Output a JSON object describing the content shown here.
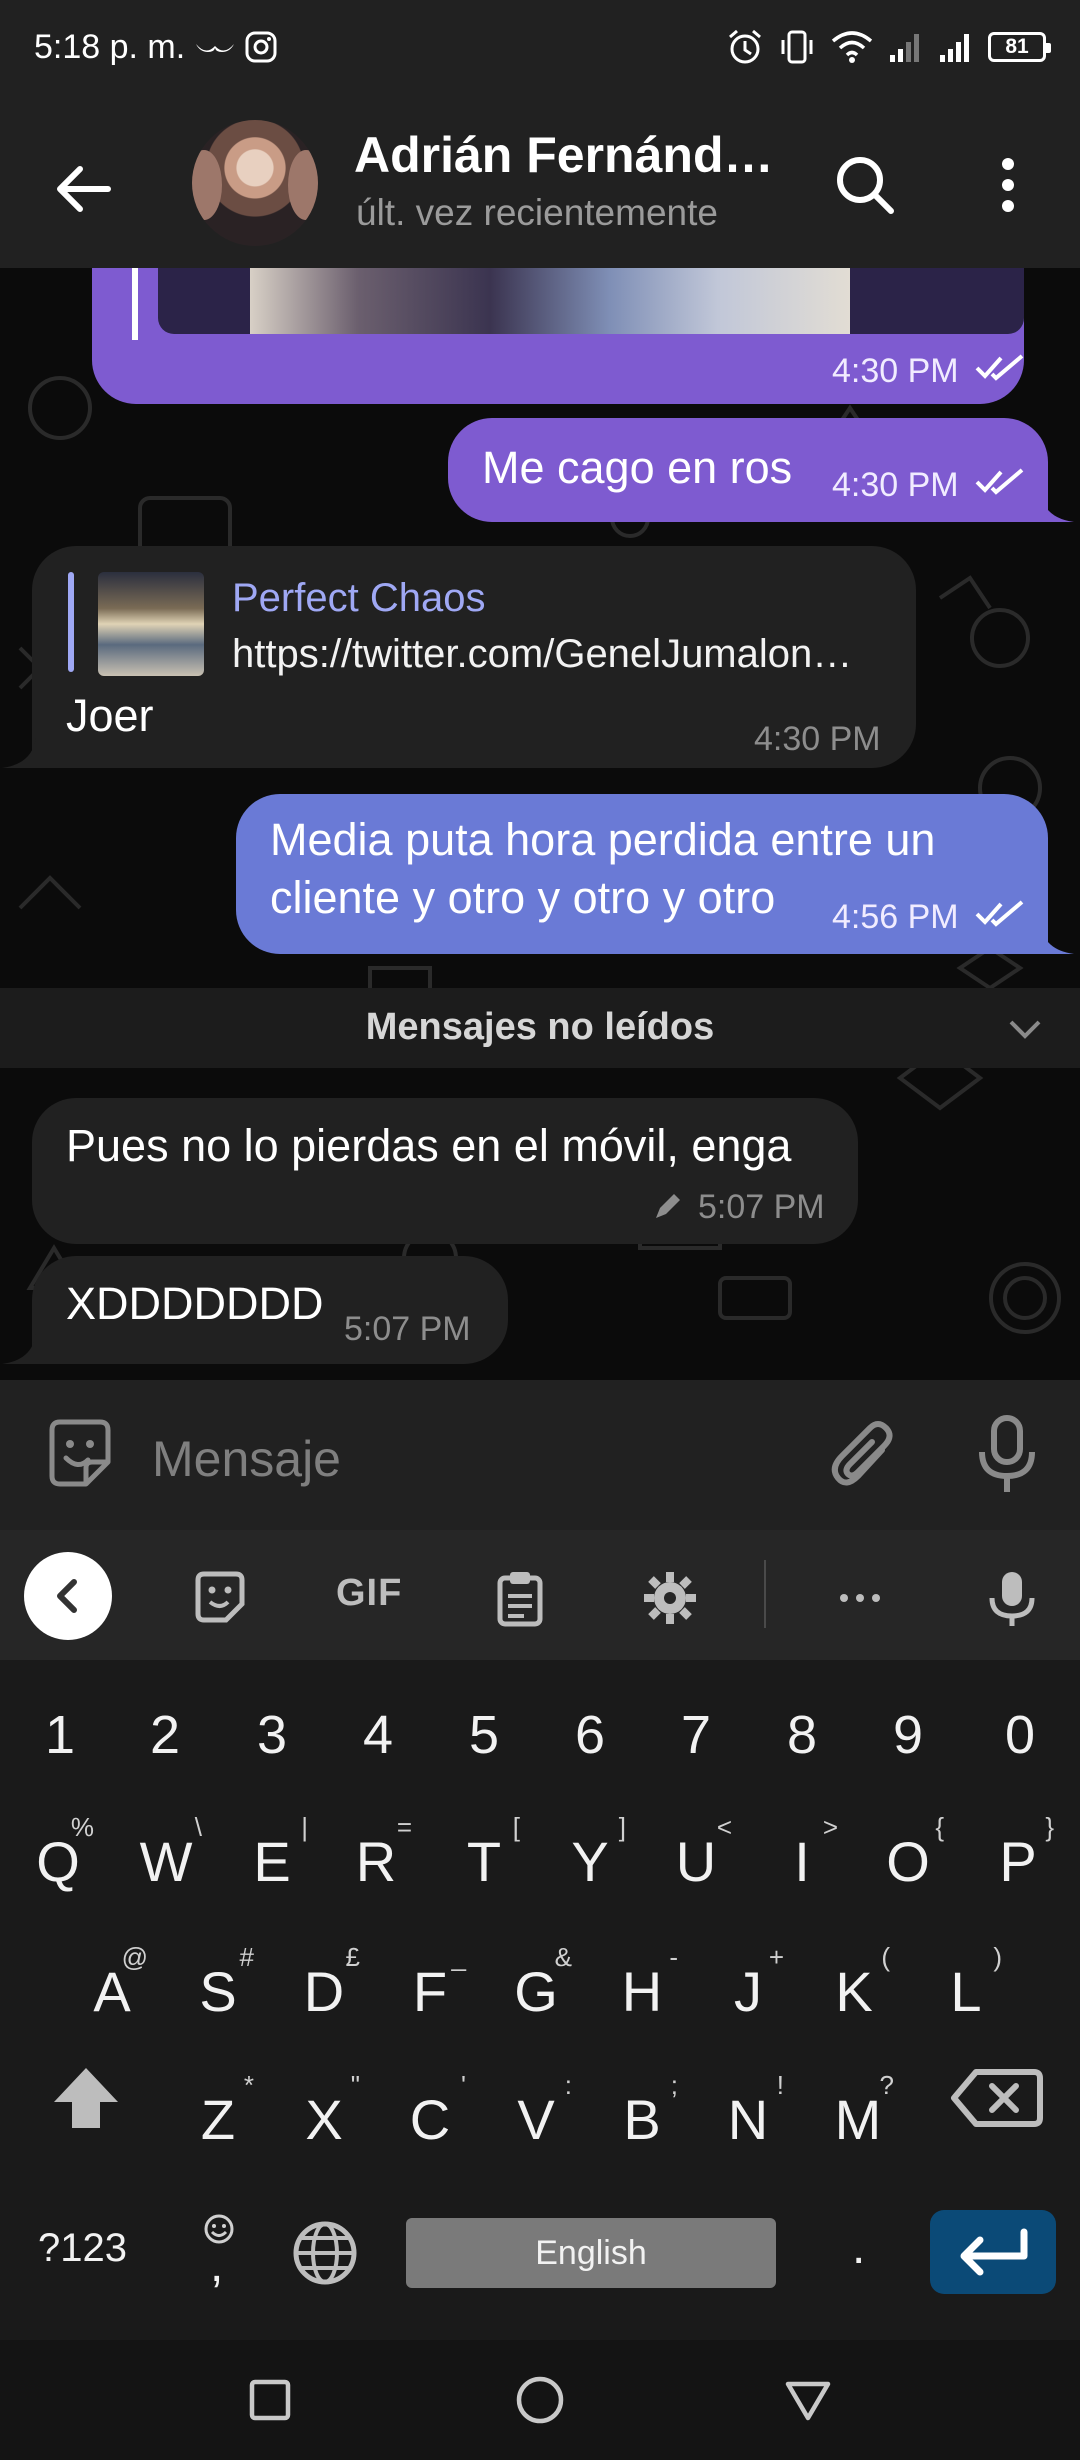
{
  "status_bar": {
    "time": "5:18 p. m.",
    "battery": "81",
    "icons": [
      "mustache-icon",
      "instagram-icon",
      "alarm-icon",
      "vibrate-icon",
      "wifi-icon",
      "signal-icon",
      "signal-icon-2"
    ]
  },
  "header": {
    "title": "Adrián Fernánd…",
    "subtitle": "últ. vez recientemente",
    "icons": [
      "back-arrow-icon",
      "search-icon",
      "more-vert-icon"
    ]
  },
  "messages": [
    {
      "id": "m0",
      "direction": "out",
      "text": "",
      "time": "4:30 PM",
      "read": true,
      "kind": "media"
    },
    {
      "id": "m1",
      "direction": "out",
      "text": "Me cago en ros",
      "time": "4:30 PM",
      "read": true
    },
    {
      "id": "m2",
      "direction": "in",
      "link_title": "Perfect Chaos",
      "link_url": "https://twitter.com/GenelJumalon…",
      "text": "Joer",
      "time": "4:30 PM"
    },
    {
      "id": "m3",
      "direction": "out",
      "lines": [
        "Media puta hora perdida entre un",
        "cliente y otro y otro y otro"
      ],
      "time": "4:56 PM",
      "read": true
    },
    {
      "id": "m4",
      "direction": "in",
      "text": "Pues no lo pierdas en el móvil, enga",
      "time": "5:07 PM",
      "edited": true
    },
    {
      "id": "m5",
      "direction": "in",
      "text": "XDDDDDDD",
      "time": "5:07 PM"
    }
  ],
  "unread_divider": "Mensajes no leídos",
  "composer": {
    "placeholder": "Mensaje"
  },
  "keyboard": {
    "toolbar_gif": "GIF",
    "number_row": [
      "1",
      "2",
      "3",
      "4",
      "5",
      "6",
      "7",
      "8",
      "9",
      "0"
    ],
    "row1": [
      {
        "k": "Q",
        "s": "%"
      },
      {
        "k": "W",
        "s": "\\"
      },
      {
        "k": "E",
        "s": "|"
      },
      {
        "k": "R",
        "s": "="
      },
      {
        "k": "T",
        "s": "["
      },
      {
        "k": "Y",
        "s": "]"
      },
      {
        "k": "U",
        "s": "<"
      },
      {
        "k": "I",
        "s": ">"
      },
      {
        "k": "O",
        "s": "{"
      },
      {
        "k": "P",
        "s": "}"
      }
    ],
    "row2": [
      {
        "k": "A",
        "s": "@"
      },
      {
        "k": "S",
        "s": "#"
      },
      {
        "k": "D",
        "s": "£"
      },
      {
        "k": "F",
        "s": "_"
      },
      {
        "k": "G",
        "s": "&"
      },
      {
        "k": "H",
        "s": "-"
      },
      {
        "k": "J",
        "s": "+"
      },
      {
        "k": "K",
        "s": "("
      },
      {
        "k": "L",
        "s": ")"
      }
    ],
    "row3": [
      {
        "k": "Z",
        "s": "*"
      },
      {
        "k": "X",
        "s": "\""
      },
      {
        "k": "C",
        "s": "'"
      },
      {
        "k": "V",
        "s": ":"
      },
      {
        "k": "B",
        "s": ";"
      },
      {
        "k": "N",
        "s": "!"
      },
      {
        "k": "M",
        "s": "?"
      }
    ],
    "symbols_key": "?123",
    "emoji_comma": ",",
    "space_label": "English",
    "period": "."
  },
  "colors": {
    "outgoing_bubble": "#7e5bd0",
    "outgoing_bubble_alt": "#6a7ad6",
    "incoming_bubble": "#212121",
    "link_title": "#9fa8f4",
    "enter_key": "#0b4a77"
  }
}
